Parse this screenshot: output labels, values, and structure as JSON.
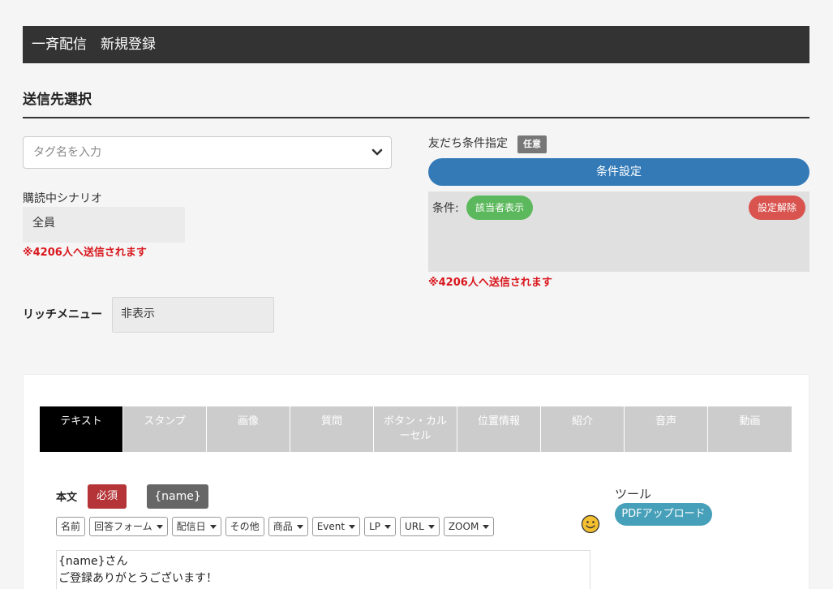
{
  "header": {
    "title": "一斉配信　新規登録"
  },
  "recipient": {
    "section_title": "送信先選択",
    "tag_placeholder": "タグ名を入力",
    "scenario_label": "購読中シナリオ",
    "scenario_value": "全員",
    "notice": "※4206人へ送信されます",
    "rich_menu_label": "リッチメニュー",
    "rich_menu_value": "非表示"
  },
  "friend_condition": {
    "label": "友だち条件指定",
    "optional_badge": "任意",
    "settings_button": "条件設定",
    "condition_prefix": "条件:",
    "match_button": "該当者表示",
    "clear_button": "設定解除",
    "notice": "※4206人へ送信されます"
  },
  "tabs": [
    {
      "label": "テキスト"
    },
    {
      "label": "スタンプ"
    },
    {
      "label": "画像"
    },
    {
      "label": "質問"
    },
    {
      "label": "ボタン・カル\nーセル"
    },
    {
      "label": "位置情報"
    },
    {
      "label": "紹介"
    },
    {
      "label": "音声"
    },
    {
      "label": "動画"
    }
  ],
  "message": {
    "body_label": "本文",
    "required_badge": "必須",
    "name_badge": "{name}",
    "toolbar": [
      {
        "label": "名前",
        "dropdown": false
      },
      {
        "label": "回答フォーム",
        "dropdown": true
      },
      {
        "label": "配信日",
        "dropdown": true
      },
      {
        "label": "その他",
        "dropdown": false
      },
      {
        "label": "商品",
        "dropdown": true
      },
      {
        "label": "Event",
        "dropdown": true
      },
      {
        "label": "LP",
        "dropdown": true
      },
      {
        "label": "URL",
        "dropdown": true
      },
      {
        "label": "ZOOM",
        "dropdown": true
      }
    ],
    "emoji_icon": "smiley-face-icon",
    "editor_lines": [
      "{name}さん",
      "ご登録ありがとうございます！"
    ]
  },
  "tools": {
    "label": "ツール",
    "pdf_button": "PDFアップロード"
  },
  "colors": {
    "header_bg": "#333333",
    "primary_blue": "#337ab7",
    "success_green": "#5cb85c",
    "danger_red": "#d9534f",
    "notice_red": "#d9161d",
    "required_red": "#b53437",
    "info_teal": "#46a0b9"
  }
}
